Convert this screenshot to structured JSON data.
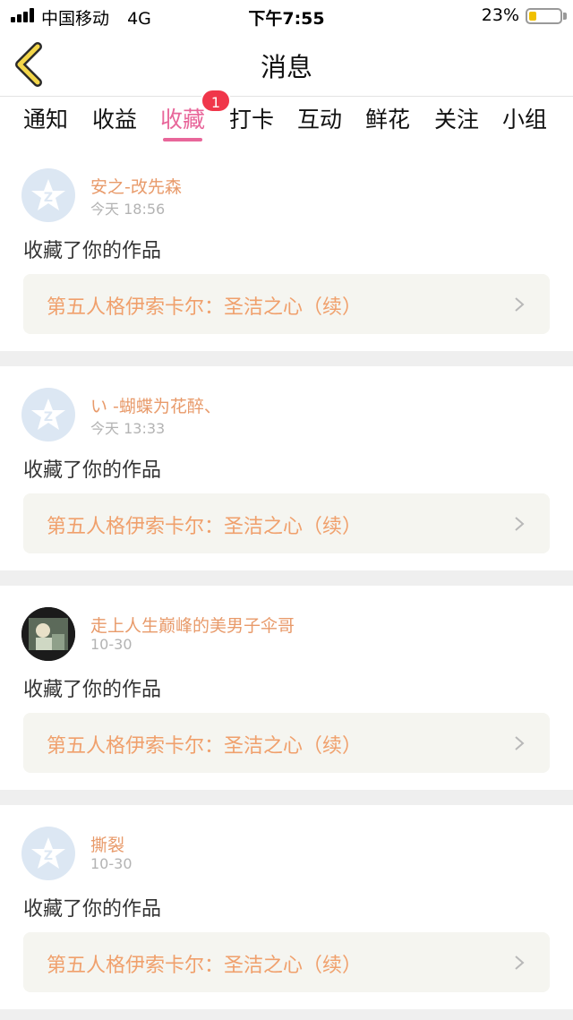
{
  "status_bar": {
    "carrier": "中国移动",
    "network": "4G",
    "time": "下午7:55",
    "battery_percent": "23%",
    "battery_level": 0.23
  },
  "header": {
    "title": "消息",
    "back_icon": "chevron-left-icon"
  },
  "tabs": {
    "items": [
      {
        "label": "通知"
      },
      {
        "label": "收益"
      },
      {
        "label": "收藏",
        "active": true,
        "badge": "1"
      },
      {
        "label": "打卡"
      },
      {
        "label": "互动"
      },
      {
        "label": "鲜花"
      },
      {
        "label": "关注"
      },
      {
        "label": "小组"
      }
    ]
  },
  "colors": {
    "accent": "#e8669a",
    "name": "#e89a6a",
    "work_title": "#f0a06c",
    "badge": "#f0364a"
  },
  "notifications": [
    {
      "user": "安之-改先森",
      "time": "今天 18:56",
      "action": "收藏了你的作品",
      "work": "第五人格伊索卡尔：圣洁之心（续）",
      "avatar": "default-avatar-icon"
    },
    {
      "user": "い -蝴蝶为花醉、",
      "time": "今天 13:33",
      "action": "收藏了你的作品",
      "work": "第五人格伊索卡尔：圣洁之心（续）",
      "avatar": "default-avatar-icon"
    },
    {
      "user": "走上人生巅峰的美男子伞哥",
      "time": "10-30",
      "action": "收藏了你的作品",
      "work": "第五人格伊索卡尔：圣洁之心（续）",
      "avatar": "photo-avatar"
    },
    {
      "user": "撕裂",
      "time": "10-30",
      "action": "收藏了你的作品",
      "work": "第五人格伊索卡尔：圣洁之心（续）",
      "avatar": "default-avatar-icon"
    }
  ]
}
